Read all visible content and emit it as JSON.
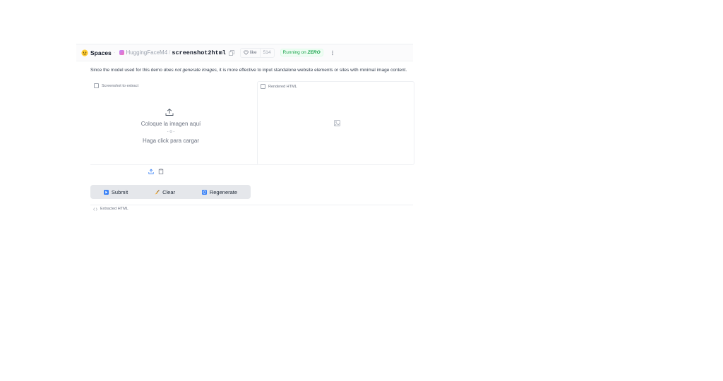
{
  "header": {
    "spaces_label": "Spaces",
    "owner": "HuggingFaceM4",
    "separator": "/",
    "space_name": "screenshot2html",
    "like_label": "like",
    "like_count": "514",
    "running_prefix": "Running on",
    "running_hw": "ZERO"
  },
  "description": {
    "before": "Since the model used for this demo ",
    "emphasis": "does not generate images",
    "after": ", it is more effective to input standalone website elements or sites with minimal image content."
  },
  "input_panel": {
    "label": "Screenshot to extract",
    "drop_text": "Coloque la imagen aquí",
    "or_text": "- o -",
    "click_text": "Haga click para cargar"
  },
  "output_panel": {
    "label": "Rendered HTML"
  },
  "buttons": {
    "submit": "Submit",
    "clear": "Clear",
    "regenerate": "Regenerate"
  },
  "code_panel": {
    "label": "Extracted HTML"
  },
  "colors": {
    "running_green": "#16a34a",
    "button_bg": "#e5e7eb",
    "submit_icon": "#3b82f6",
    "regenerate_icon": "#3b82f6"
  }
}
